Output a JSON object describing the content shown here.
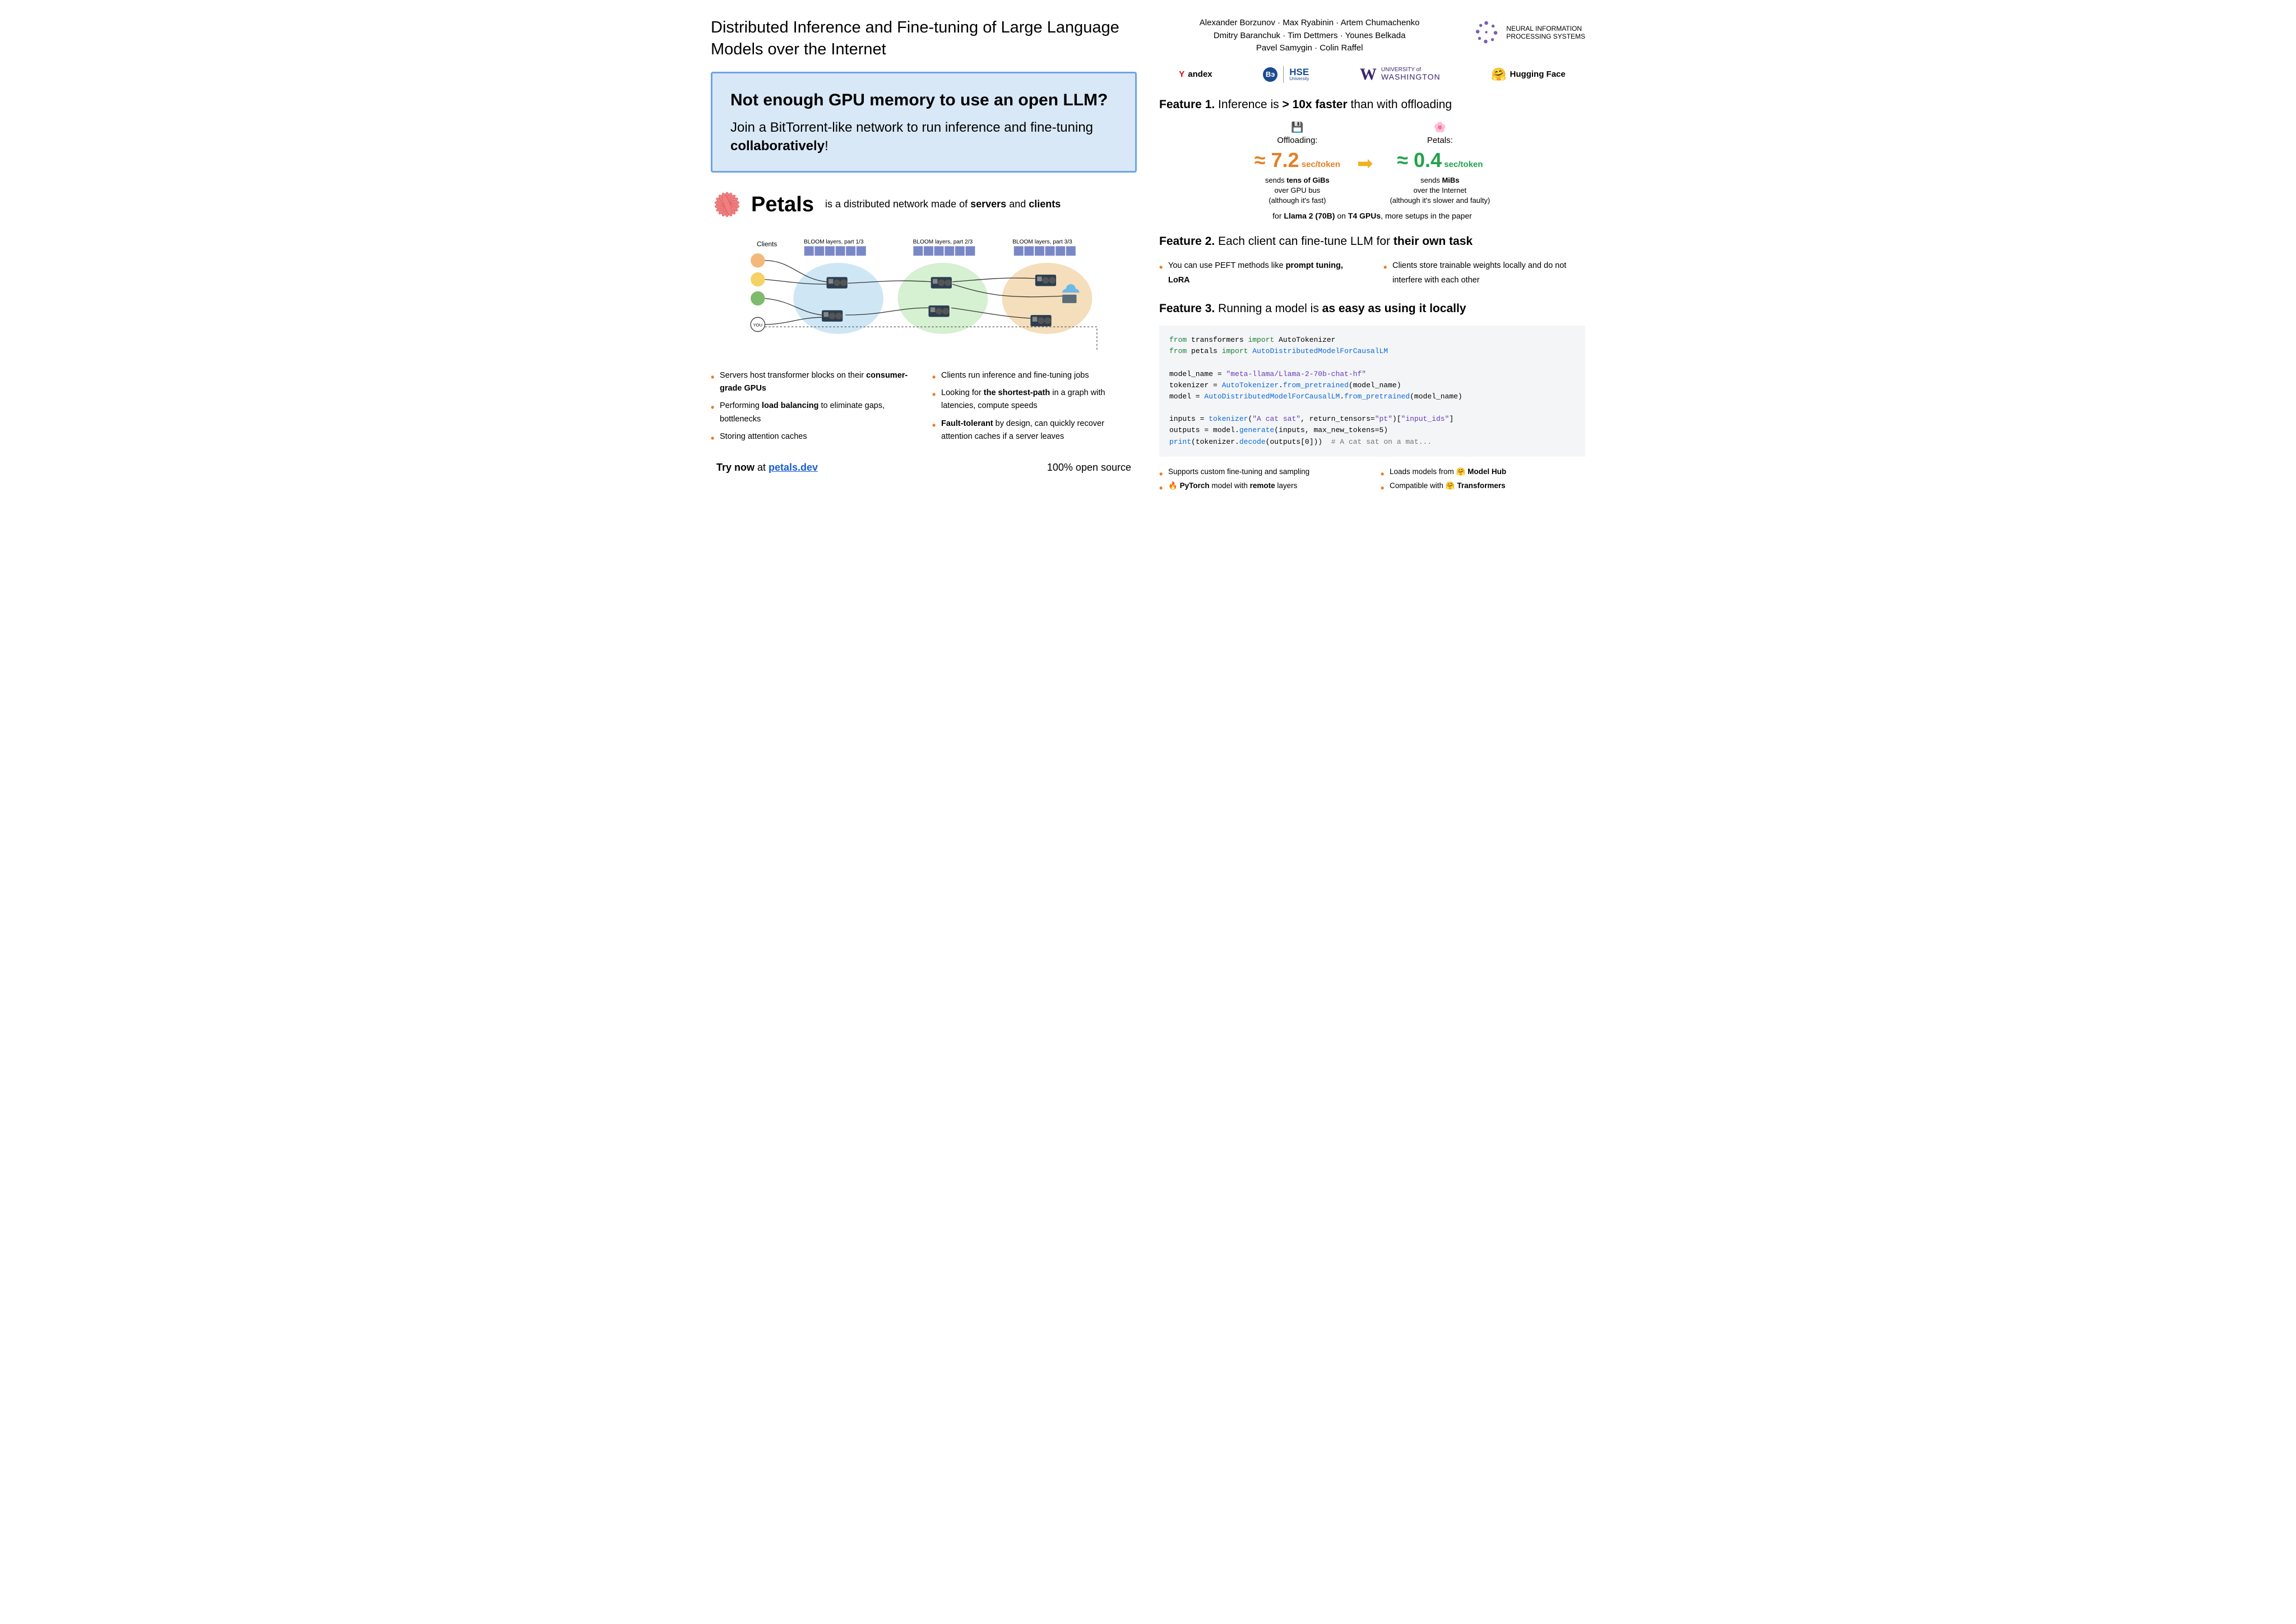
{
  "title": "Distributed Inference and Fine-tuning of Large Language Models over the Internet",
  "authors": "Alexander Borzunov · Max Ryabinin · Artem Chumachenko\nDmitry Baranchuk · Tim Dettmers · Younes Belkada\nPavel Samygin · Colin Raffel",
  "neurips": "NEURAL INFORMATION\nPROCESSING SYSTEMS",
  "logos": {
    "yandex": "Yandex",
    "hse": "HSE",
    "hse_sub": "University",
    "uw_small": "UNIVERSITY of",
    "uw_big": "WASHINGTON",
    "hf": "Hugging Face"
  },
  "callout": {
    "heading": "Not enough GPU memory to use an open LLM?",
    "body_pre": "Join a BitTorrent-like network to run inference and fine-tuning ",
    "body_strong": "collaboratively",
    "body_post": "!"
  },
  "petals": {
    "name": "Petals",
    "desc_pre": "is a distributed network made of ",
    "desc_s1": "servers",
    "desc_mid": " and ",
    "desc_s2": "clients"
  },
  "diagram_labels": {
    "clients": "Clients",
    "p1": "BLOOM layers, part 1/3",
    "p2": "BLOOM layers, part 2/3",
    "p3": "BLOOM layers, part 3/3",
    "you": "YOU"
  },
  "list_servers": [
    {
      "pre": "Servers host transformer blocks on their ",
      "b": "consumer-grade GPUs",
      "post": ""
    },
    {
      "pre": "Performing ",
      "b": "load balancing",
      "post": " to eliminate gaps, bottlenecks"
    },
    {
      "pre": "Storing attention caches",
      "b": "",
      "post": ""
    }
  ],
  "list_clients": [
    {
      "pre": "Clients run inference and fine-tuning jobs",
      "b": "",
      "post": ""
    },
    {
      "pre": "Looking for ",
      "b": "the shortest-path",
      "post": " in a graph with latencies, compute speeds"
    },
    {
      "pre": "",
      "b": "Fault-tolerant",
      "post": " by design, can quickly recover attention caches if a server leaves"
    }
  ],
  "try": {
    "pre": "Try now ",
    "at": "at ",
    "link": "petals.dev",
    "open": "100% open source"
  },
  "feature1": {
    "num": "Feature 1.",
    "rest_pre": " Inference is ",
    "rest_b": "> 10x faster",
    "rest_post": " than with offloading",
    "off_label": "Offloading:",
    "off_val": "≈ 7.2",
    "off_unit": " sec/token",
    "off_d1": "sends ",
    "off_d1b": "tens of GiBs",
    "off_d2": "over GPU bus",
    "off_d3": "(although it's fast)",
    "pet_label": "Petals:",
    "pet_val": "≈ 0.4",
    "pet_unit": " sec/token",
    "pet_d1": "sends ",
    "pet_d1b": "MiBs",
    "pet_d2": "over the Internet",
    "pet_d3": "(although it's slower and faulty)",
    "foot_pre": "for ",
    "foot_b1": "Llama 2 (70B)",
    "foot_mid": " on ",
    "foot_b2": "T4 GPUs",
    "foot_post": ", more setups in the paper"
  },
  "feature2": {
    "num": "Feature 2.",
    "rest_pre": " Each client can fine-tune LLM for ",
    "rest_b": "their own task",
    "l1_pre": "You can use PEFT methods like ",
    "l1_b": "prompt tuning, LoRA",
    "r1": "Clients store trainable weights locally and do not interfere with each other"
  },
  "feature3": {
    "num": "Feature 3.",
    "rest_pre": " Running a model is ",
    "rest_b": "as easy as using it locally",
    "code": {
      "l1_a": "from",
      "l1_b": " transformers ",
      "l1_c": "import",
      "l1_d": " AutoTokenizer",
      "l2_a": "from",
      "l2_b": " petals ",
      "l2_c": "import",
      "l2_d": " AutoDistributedModelForCausalLM",
      "l3_a": "model_name = ",
      "l3_b": "\"meta-llama/Llama-2-70b-chat-hf\"",
      "l4_a": "tokenizer = ",
      "l4_b": "AutoTokenizer",
      "l4_c": ".",
      "l4_d": "from_pretrained",
      "l4_e": "(model_name)",
      "l5_a": "model = ",
      "l5_b": "AutoDistributedModelForCausalLM",
      "l5_c": ".",
      "l5_d": "from_pretrained",
      "l5_e": "(model_name)",
      "l6_a": "inputs = ",
      "l6_b": "tokenizer",
      "l6_c": "(",
      "l6_d": "\"A cat sat\"",
      "l6_e": ", return_tensors=",
      "l6_f": "\"pt\"",
      "l6_g": ")[",
      "l6_h": "\"input_ids\"",
      "l6_i": "]",
      "l7_a": "outputs = model.",
      "l7_b": "generate",
      "l7_c": "(inputs, max_new_tokens=",
      "l7_d": "5",
      "l7_e": ")",
      "l8_a": "print",
      "l8_b": "(tokenizer.",
      "l8_c": "decode",
      "l8_d": "(outputs[",
      "l8_e": "0",
      "l8_f": "]))  ",
      "l8_g": "# A cat sat on a mat..."
    },
    "bl1": "Supports custom fine-tuning and sampling",
    "bl2_pre": "🔥 ",
    "bl2_b1": "PyTorch",
    "bl2_mid": " model with ",
    "bl2_b2": "remote",
    "bl2_post": " layers",
    "br1_pre": "Loads models from 🤗 ",
    "br1_b": "Model Hub",
    "br2_pre": "Compatible with 🤗 ",
    "br2_b": "Transformers"
  }
}
